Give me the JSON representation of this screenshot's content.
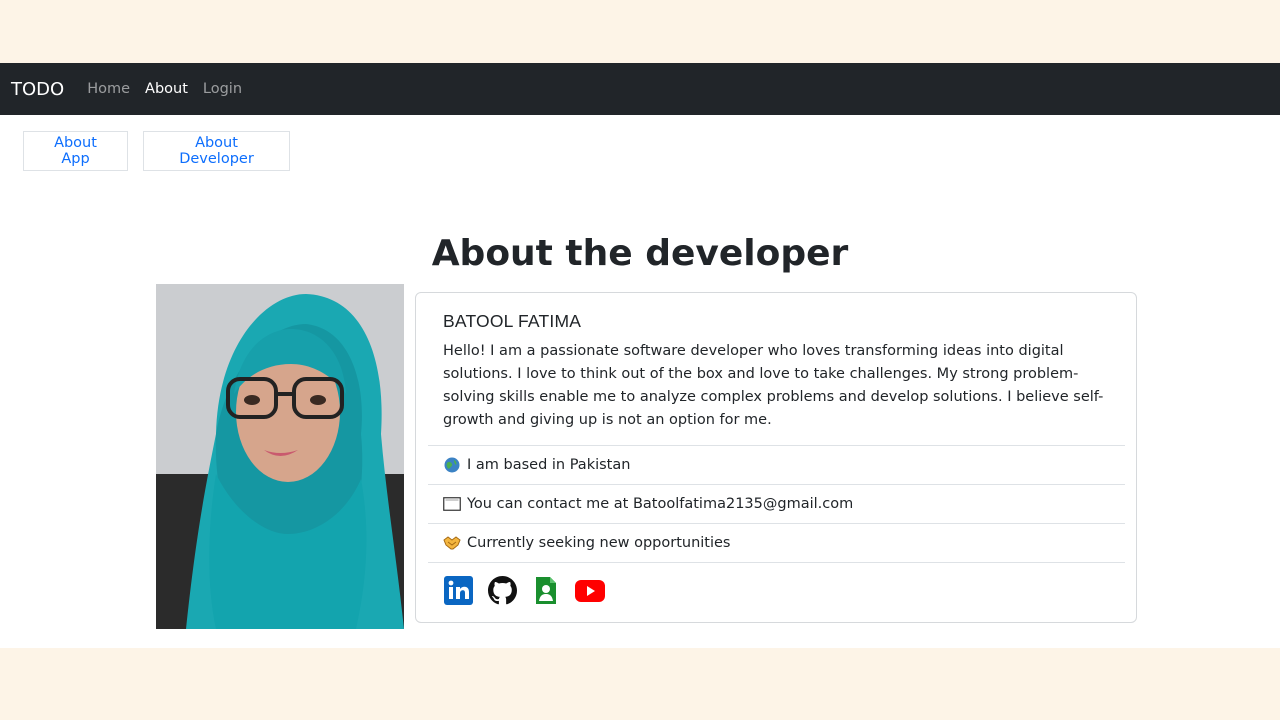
{
  "navbar": {
    "brand": "TODO",
    "links": [
      {
        "label": "Home",
        "active": false
      },
      {
        "label": "About",
        "active": true
      },
      {
        "label": "Login",
        "active": false
      }
    ]
  },
  "tabs": {
    "about_app": "About App",
    "about_developer": "About Developer"
  },
  "main": {
    "heading": "About the developer",
    "card": {
      "name": "BATOOL FATIMA",
      "bio": "Hello! I am a passionate software developer who loves transforming ideas into digital solutions. I love to think out of the box and love to take challenges. My strong problem-solving skills enable me to analyze complex problems and develop solutions. I believe self-growth and giving up is not an option for me.",
      "facts": [
        {
          "icon": "globe-icon",
          "text": "I am based in Pakistan"
        },
        {
          "icon": "envelope-icon",
          "text": "You can contact me at Batoolfatima2135@gmail.com"
        },
        {
          "icon": "handshake-icon",
          "text": "Currently seeking new opportunities"
        }
      ],
      "social": [
        "linkedin-icon",
        "github-icon",
        "portfolio-icon",
        "youtube-icon"
      ]
    }
  },
  "colors": {
    "navbar_bg": "#212529",
    "link_blue": "#0d6efd",
    "page_outer_bg": "#fdf4e7"
  }
}
